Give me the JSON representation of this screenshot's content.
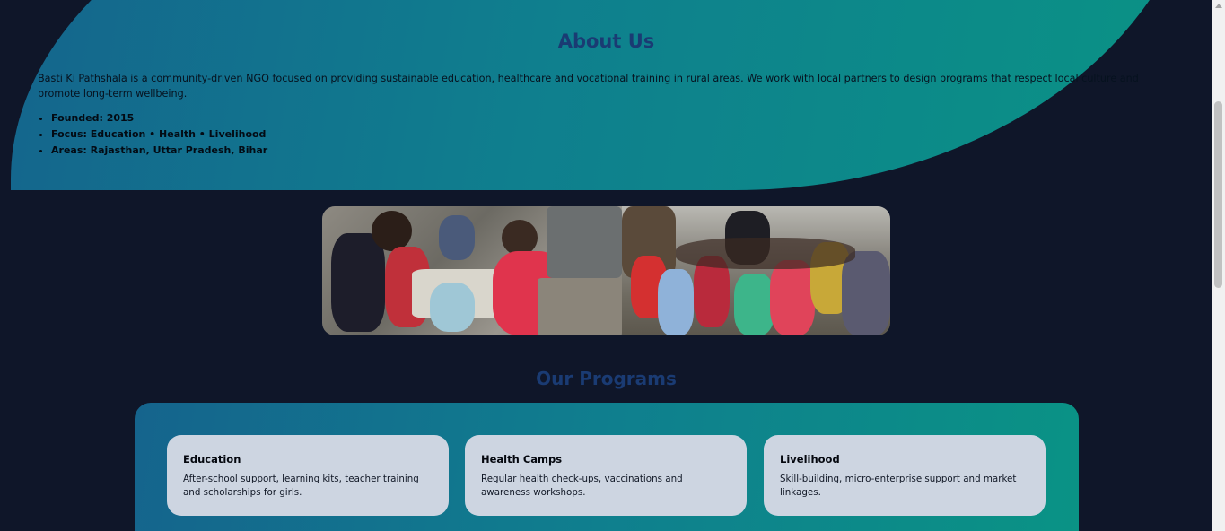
{
  "about": {
    "title": "About Us",
    "description": "Basti Ki Pathshala is a community-driven NGO focused on providing sustainable education, healthcare and vocational training in rural areas. We work with local partners to design programs that respect local culture and promote long-term wellbeing.",
    "facts": [
      "Founded: 2015",
      "Focus: Education • Health • Livelihood",
      "Areas: Rajasthan, Uttar Pradesh, Bihar"
    ]
  },
  "programs": {
    "title": "Our Programs",
    "items": [
      {
        "title": "Education",
        "description": "After-school support, learning kits, teacher training and scholarships for girls."
      },
      {
        "title": "Health Camps",
        "description": "Regular health check-ups, vaccinations and awareness workshops."
      },
      {
        "title": "Livelihood",
        "description": "Skill-building, micro-enterprise support and market linkages."
      }
    ]
  },
  "colors": {
    "background": "#0f1629",
    "heading": "#1a3b73",
    "gradient_start": "#15648d",
    "gradient_end": "#0a9385",
    "card": "#cdd5e1"
  }
}
